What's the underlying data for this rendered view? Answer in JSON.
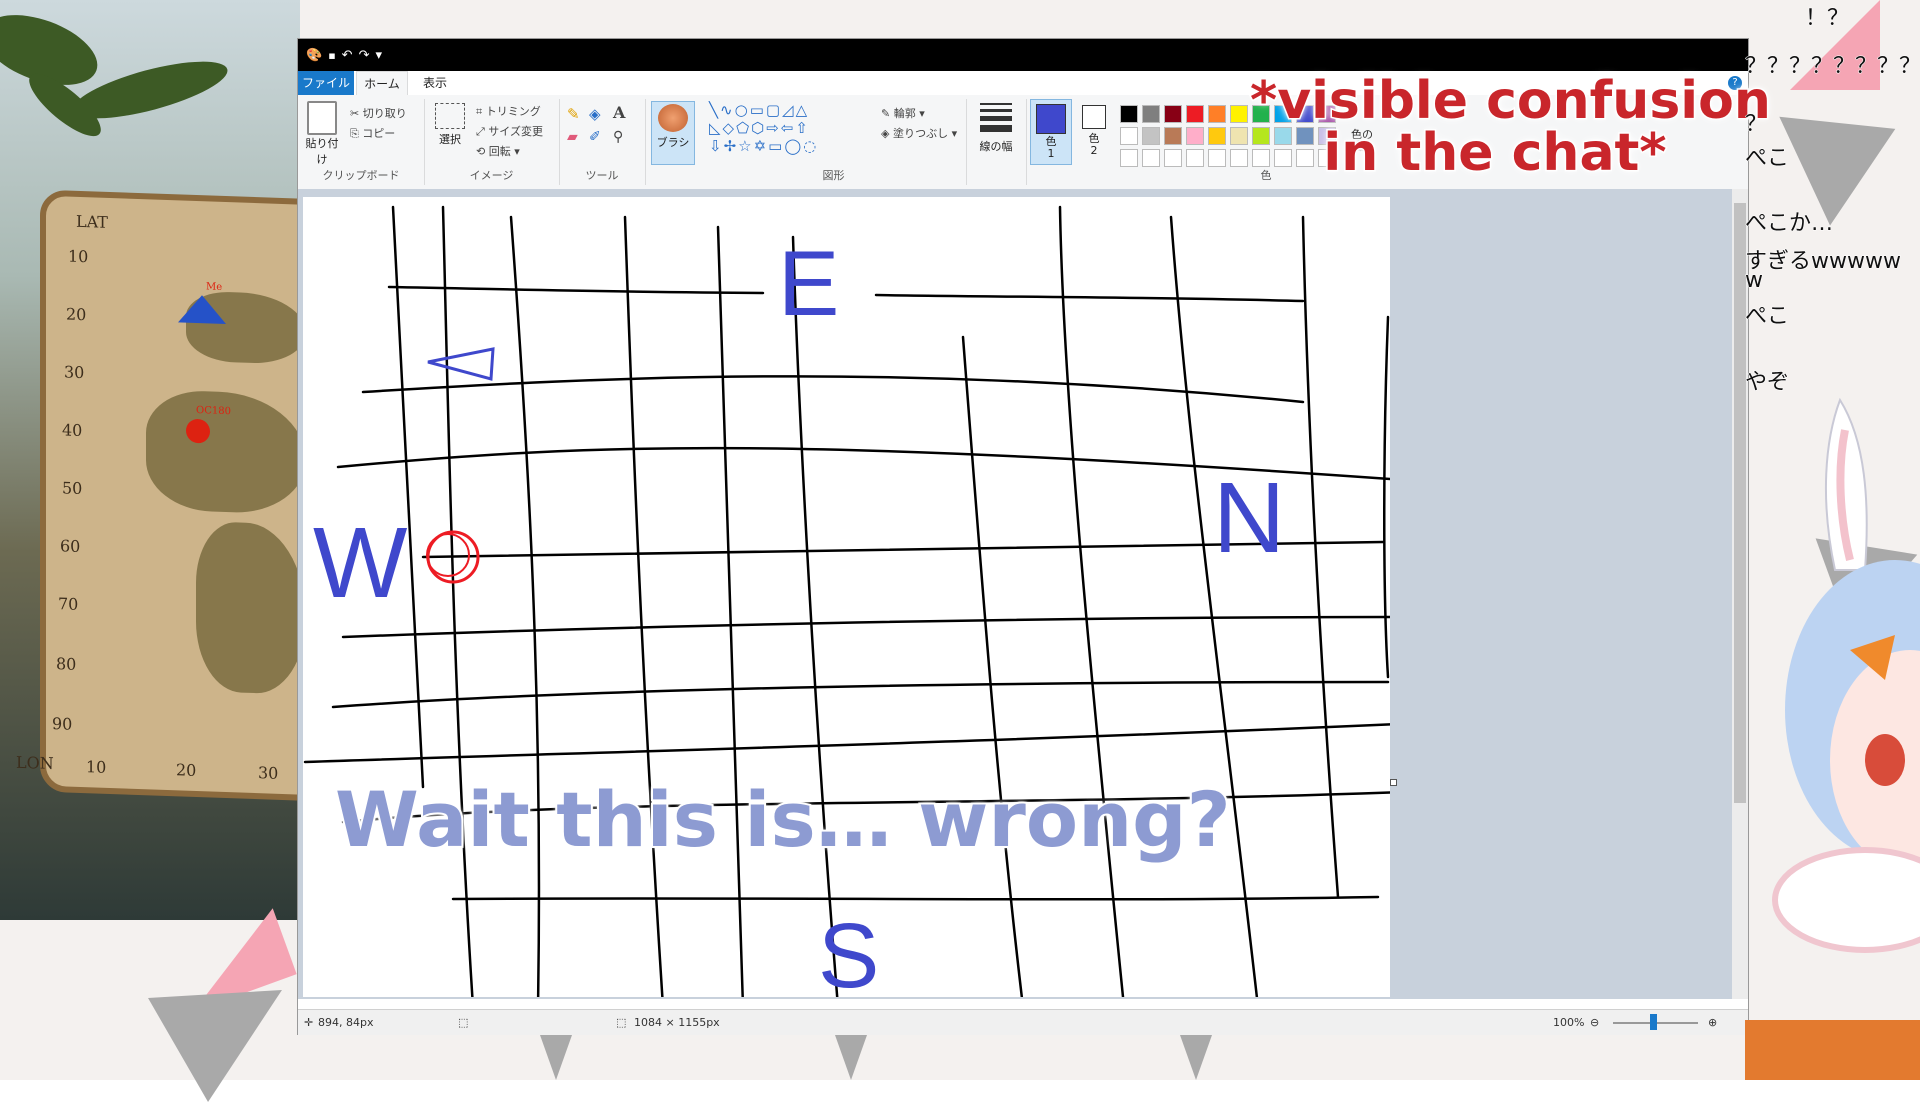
{
  "paint": {
    "menu": {
      "file": "ファイル",
      "home": "ホーム",
      "view": "表示"
    },
    "clipboard": {
      "paste": "貼り付け",
      "cut": "切り取り",
      "copy": "コピー",
      "group": "クリップボード"
    },
    "image": {
      "select": "選択",
      "crop": "トリミング",
      "resize": "サイズ変更",
      "rotate": "回転",
      "group": "イメージ"
    },
    "tools": {
      "group": "ツール",
      "brush": "ブラシ"
    },
    "shapes": {
      "outline": "輪郭",
      "fill": "塗りつぶし",
      "group": "図形"
    },
    "size": {
      "label": "線の幅"
    },
    "colors": {
      "color1": "色\n1",
      "color2": "色\n2",
      "edit": "色の\n編集",
      "group": "色",
      "palette": [
        "#000000",
        "#7f7f7f",
        "#880015",
        "#ed1c24",
        "#ff7f27",
        "#fff200",
        "#22b14c",
        "#00a2e8",
        "#3f48cc",
        "#a349a4",
        "#ffffff",
        "#c3c3c3",
        "#b97a57",
        "#ffaec9",
        "#ffc90e",
        "#efe4b0",
        "#b5e61d",
        "#99d9ea",
        "#7092be",
        "#c8bfe7"
      ]
    },
    "status": {
      "cursor": "894, 84px",
      "size": "1084 × 1155px",
      "zoom": "100%"
    }
  },
  "drawing": {
    "letters": {
      "e": "E",
      "w": "W",
      "n": "N",
      "s": "S"
    }
  },
  "map": {
    "lat": "LAT",
    "lon": "LON",
    "lat_ticks": [
      "10",
      "20",
      "30",
      "40",
      "50",
      "60",
      "70",
      "80",
      "90"
    ],
    "lon_ticks": [
      "10",
      "20",
      "30"
    ],
    "me": "Me",
    "marker2": "OC180"
  },
  "captions": {
    "top_line1": "*visible confusion",
    "top_line2": "in the chat*",
    "bottom": "Wait this is… wrong?"
  },
  "chat": [
    "！？",
    "？？？？？？？？",
    "？",
    "ぺこ",
    "ぺこか…",
    "すぎるwwwww",
    "w",
    "ぺこ",
    "やぞ"
  ]
}
